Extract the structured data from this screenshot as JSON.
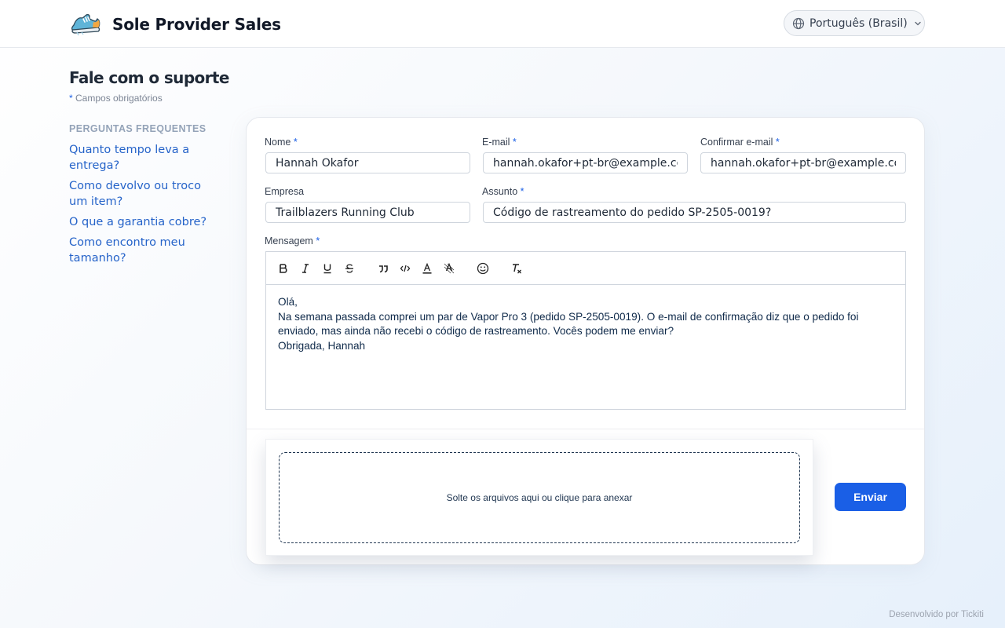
{
  "header": {
    "brand_name": "Sole Provider Sales",
    "logo_icon": "sneaker-logo",
    "language": {
      "selected": "Português (Brasil)",
      "icon": "globe-icon"
    }
  },
  "sidebar": {
    "title": "Fale com o suporte",
    "required_note": {
      "asterisk": "*",
      "text": " Campos obrigatórios"
    },
    "faq_heading": "PERGUNTAS FREQUENTES",
    "faq": [
      {
        "label": "Quanto tempo leva a entrega?"
      },
      {
        "label": "Como devolvo ou troco um item?"
      },
      {
        "label": "O que a garantia cobre?"
      },
      {
        "label": "Como encontro meu tamanho?"
      }
    ]
  },
  "form": {
    "required_marker": "*",
    "name": {
      "label": "Nome",
      "value": "Hannah Okafor"
    },
    "email": {
      "label": "E-mail",
      "value": "hannah.okafor+pt-br@example.com"
    },
    "confirm_email": {
      "label": "Confirmar e-mail",
      "value": "hannah.okafor+pt-br@example.com"
    },
    "company": {
      "label": "Empresa",
      "value": "Trailblazers Running Club"
    },
    "subject": {
      "label": "Assunto",
      "value": "Código de rastreamento do pedido SP-2505-0019?"
    },
    "message": {
      "label": "Mensagem",
      "lines": [
        "Olá,",
        "Na semana passada comprei um par de Vapor Pro 3 (pedido SP-2505-0019). O e-mail de confirmação diz que o pedido foi enviado, mas ainda não recebi o código de rastreamento. Vocês podem me enviar?",
        "Obrigada, Hannah"
      ]
    },
    "toolbar": [
      "bold-icon",
      "italic-icon",
      "underline-icon",
      "strikethrough-icon",
      "quote-icon",
      "code-icon",
      "font-color-icon",
      "highlight-icon",
      "emoji-icon",
      "clear-format-icon"
    ],
    "attachments": {
      "label": "Solte os arquivos aqui ou clique para anexar"
    },
    "submit_label": "Enviar"
  },
  "footer": {
    "credit": "Desenvolvido por Tickiti"
  },
  "colors": {
    "accent": "#1a5fe6",
    "link": "#2563c9",
    "faq_heading": "#94a3b8"
  }
}
